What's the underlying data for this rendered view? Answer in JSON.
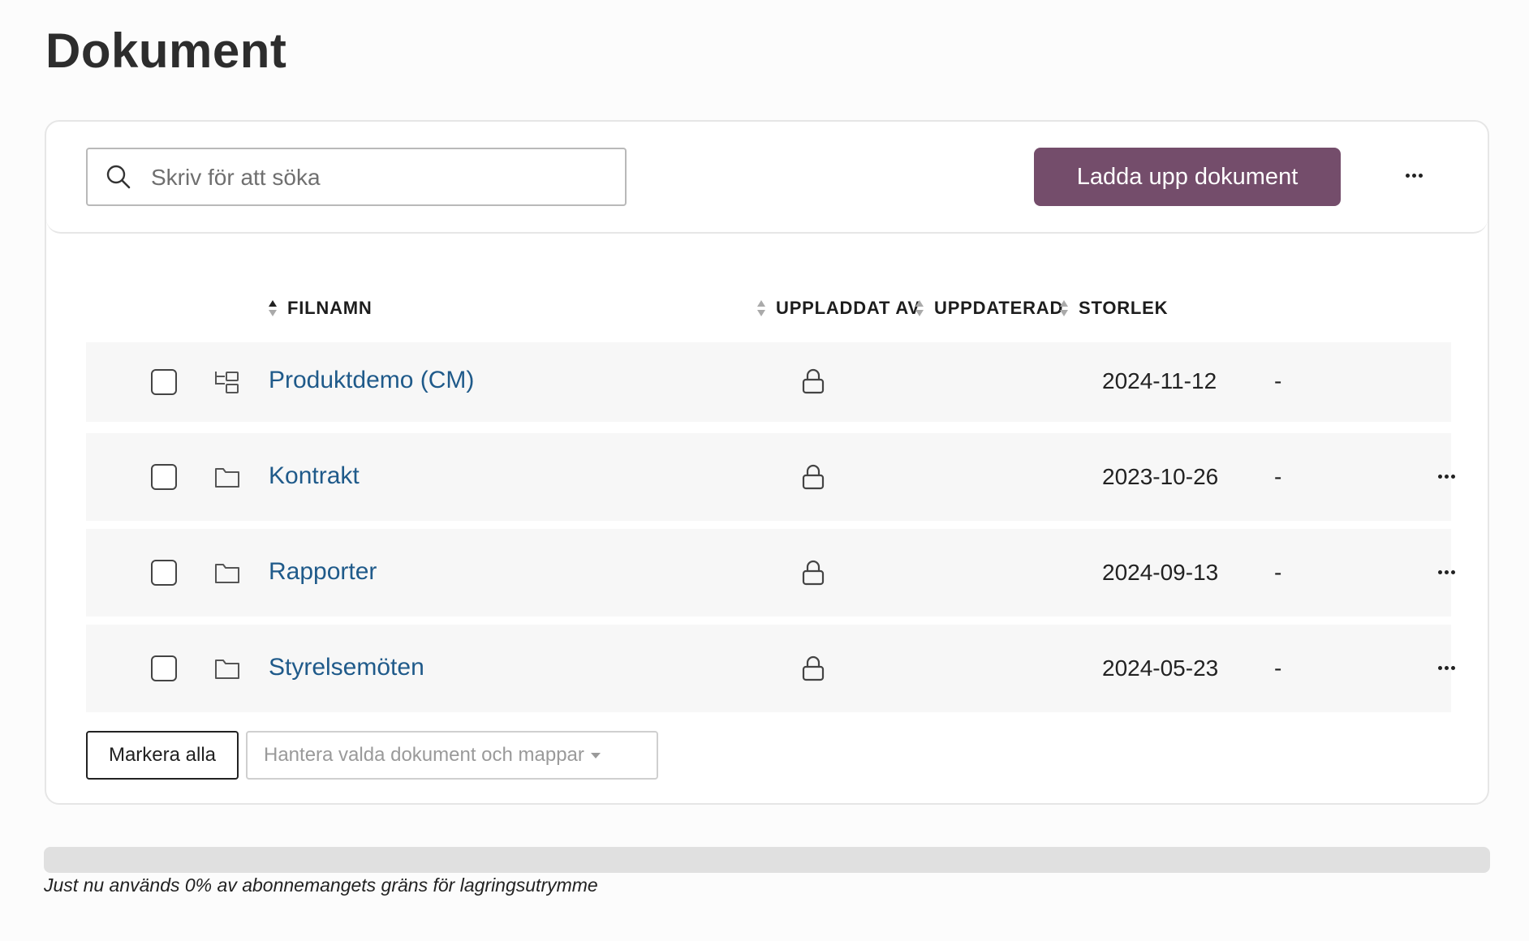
{
  "page": {
    "title": "Dokument"
  },
  "toolbar": {
    "search_placeholder": "Skriv för att söka",
    "upload_label": "Ladda upp dokument",
    "more_icon": "more-horizontal-icon"
  },
  "table": {
    "columns": {
      "filename": "FILNAMN",
      "uploaded_by": "UPPLADDAT AV",
      "updated": "UPPDATERAD",
      "size": "STORLEK"
    },
    "rows": [
      {
        "type_icon": "folder-tree-icon",
        "name": "Produktdemo (CM)",
        "locked": true,
        "updated": "2024-11-12",
        "size": "-",
        "has_menu": false
      },
      {
        "type_icon": "folder-icon",
        "name": "Kontrakt",
        "locked": true,
        "updated": "2023-10-26",
        "size": "-",
        "has_menu": true
      },
      {
        "type_icon": "folder-icon",
        "name": "Rapporter",
        "locked": true,
        "updated": "2024-09-13",
        "size": "-",
        "has_menu": true
      },
      {
        "type_icon": "folder-icon",
        "name": "Styrelsemöten",
        "locked": true,
        "updated": "2024-05-23",
        "size": "-",
        "has_menu": true
      }
    ]
  },
  "bulk": {
    "select_all_label": "Markera alla",
    "manage_label": "Hantera valda dokument och mappar"
  },
  "storage": {
    "used_percent": 0,
    "text": "Just nu används 0% av abonnemangets gräns för lagringsutrymme"
  },
  "colors": {
    "accent": "#744d6b",
    "link": "#1f5a8a",
    "row_bg": "#f7f7f7"
  }
}
